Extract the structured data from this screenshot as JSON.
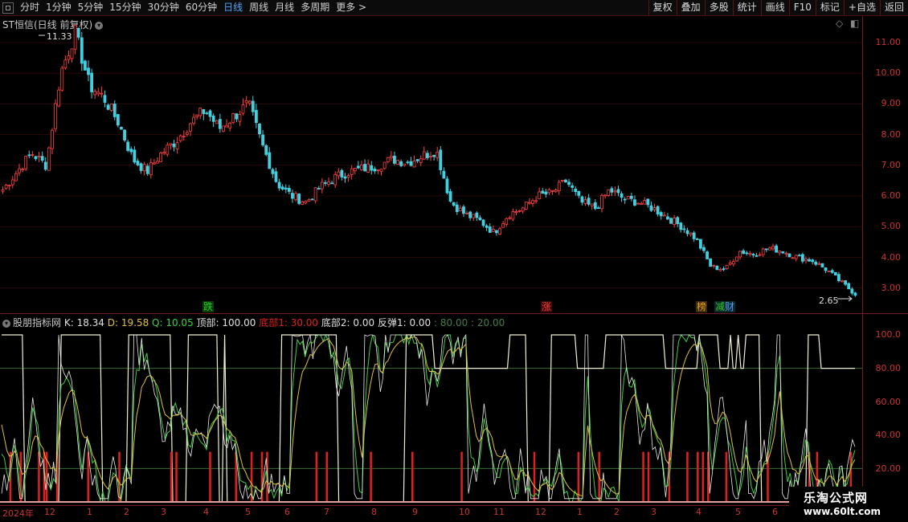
{
  "toolbar": {
    "periods": [
      "分时",
      "1分钟",
      "5分钟",
      "15分钟",
      "30分钟",
      "60分钟",
      "日线",
      "周线",
      "月线",
      "多周期",
      "更多 >"
    ],
    "active_period": "日线",
    "right_buttons": [
      "复权",
      "叠加",
      "多股",
      "统计",
      "画线",
      "F10",
      "标记",
      "+自选",
      "返回"
    ]
  },
  "main_panel": {
    "title": "ST恒信(日线 前复权)",
    "high_label": "11.33",
    "low_label": "2.65",
    "y_ticks": [
      "11.00",
      "10.00",
      "9.00",
      "8.00",
      "7.00",
      "6.00",
      "5.00",
      "4.00",
      "3.00"
    ],
    "tags": [
      {
        "text": "跌",
        "color": "#28c828"
      },
      {
        "text": "涨",
        "color": "#ff3b3b"
      },
      {
        "text": "榜",
        "color": "#e8a020"
      },
      {
        "text": "减",
        "color": "#28c828"
      },
      {
        "text": "财",
        "color": "#4e9cff"
      }
    ]
  },
  "indicator_panel": {
    "name": "股朋指标网",
    "items": [
      {
        "label": "K: 18.34",
        "color": "#e0e0e0"
      },
      {
        "label": "D: 19.58",
        "color": "#e0c040"
      },
      {
        "label": "Q: 10.05",
        "color": "#3ecf3e"
      },
      {
        "label": "顶部: 100.00",
        "color": "#e0e0e0"
      },
      {
        "label": "底部1: 30.00",
        "color": "#e02020"
      },
      {
        "label": "底部2: 0.00",
        "color": "#e0e0e0"
      },
      {
        "label": "反弹1: 0.00",
        "color": "#e0e0e0"
      },
      {
        "label": ": 80.00",
        "color": "#4a7a4a"
      },
      {
        "label": ": 20.00",
        "color": "#4a7a4a"
      }
    ],
    "y_ticks": [
      "100.0",
      "80.00",
      "60.00",
      "40.00",
      "20.00"
    ]
  },
  "x_axis": [
    "2024年",
    "12",
    "1",
    "2",
    "3",
    "4",
    "5",
    "6",
    "7",
    "8",
    "9",
    "10",
    "11",
    "12",
    "1",
    "2",
    "3",
    "4",
    "5",
    "6"
  ],
  "watermark": {
    "line1": "乐淘公式网",
    "line2": "www.60lt.com"
  },
  "chart_data": {
    "type": "candlestick",
    "price_series_approx": [
      6.2,
      6.8,
      7.4,
      7.0,
      10.0,
      11.33,
      9.6,
      9.2,
      8.4,
      7.2,
      6.8,
      7.4,
      7.8,
      8.4,
      8.8,
      8.2,
      8.6,
      9.0,
      7.6,
      6.4,
      6.0,
      5.8,
      6.3,
      6.6,
      6.8,
      6.9,
      7.0,
      7.2,
      7.1,
      7.3,
      7.5,
      5.8,
      5.4,
      5.2,
      4.8,
      5.4,
      5.6,
      6.0,
      6.1,
      6.5,
      5.8,
      5.6,
      6.2,
      5.9,
      5.8,
      5.6,
      5.3,
      5.0,
      4.6,
      3.7,
      3.6,
      4.2,
      4.1,
      4.3,
      4.2,
      4.0,
      3.9,
      3.6,
      3.2,
      2.8
    ],
    "indicator": {
      "K": 18.34,
      "D": 19.58,
      "Q": 10.05,
      "top": 100.0,
      "bottom1": 30.0,
      "bottom2": 0.0,
      "rebound1": 0.0,
      "upper_line": 80.0,
      "lower_line": 20.0
    }
  }
}
